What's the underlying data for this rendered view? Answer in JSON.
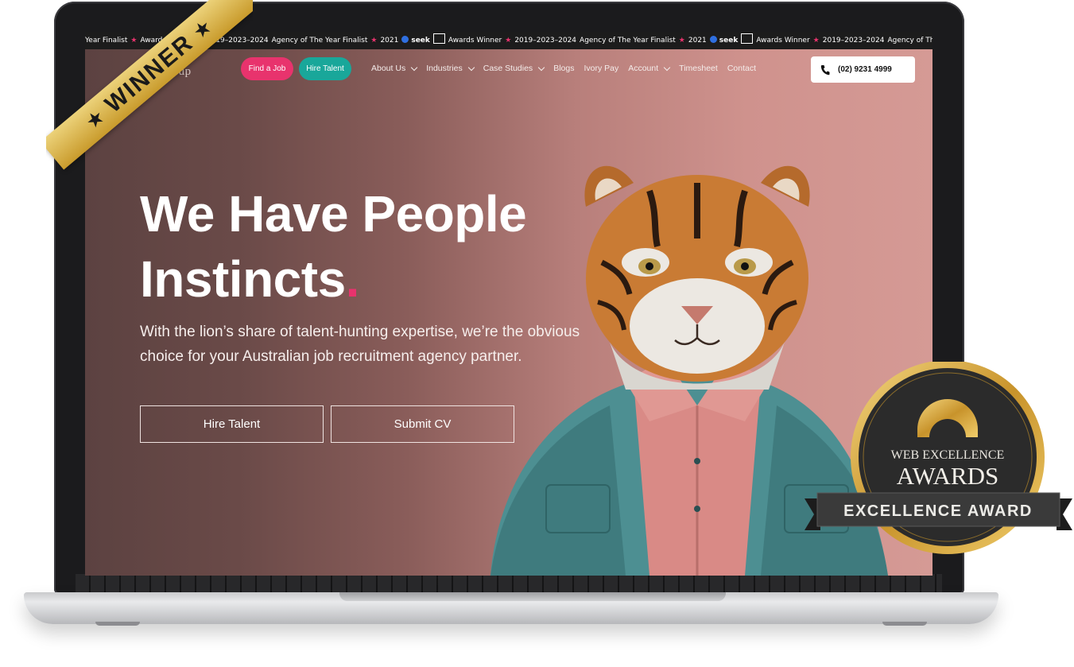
{
  "ticker": {
    "items": [
      "Year Finalist",
      "★",
      "Awards Winner",
      "★",
      "2019–2023–2024",
      "Agency of The Year Finalist",
      "★",
      "2021",
      "seek",
      "Awards Winner",
      "★",
      "2019–2023–2024",
      "Agency of The Year Finalist",
      "★",
      "2021",
      "seek",
      "Awards Winner",
      "★",
      "2019–2023–2024",
      "Agency of The Year"
    ]
  },
  "header": {
    "logo_text": "ivorygroup",
    "find_job": "Find a Job",
    "hire_talent": "Hire Talent",
    "nav": [
      {
        "label": "About Us",
        "dropdown": true
      },
      {
        "label": "Industries",
        "dropdown": true
      },
      {
        "label": "Case Studies",
        "dropdown": true
      },
      {
        "label": "Blogs",
        "dropdown": false
      },
      {
        "label": "Ivory Pay",
        "dropdown": false
      },
      {
        "label": "Account",
        "dropdown": true
      },
      {
        "label": "Timesheet",
        "dropdown": false
      },
      {
        "label": "Contact",
        "dropdown": false
      }
    ],
    "phone": "(02) 9231 4999"
  },
  "hero": {
    "headline_line1": "We Have People",
    "headline_line2": "Instincts",
    "headline_dot": ".",
    "subtext": "With the lion’s share of talent-hunting expertise, we’re the obvious choice for your Australian job recruitment agency partner.",
    "cta_hire": "Hire Talent",
    "cta_cv": "Submit CV"
  },
  "ribbon": {
    "label": "WINNER",
    "star": "★"
  },
  "badge": {
    "line1": "WEB EXCELLENCE",
    "line2": "AWARDS",
    "banner": "EXCELLENCE AWARD"
  },
  "colors": {
    "accent_pink": "#e8336d",
    "accent_teal": "#19a79a",
    "gold": "#d4a53a"
  }
}
